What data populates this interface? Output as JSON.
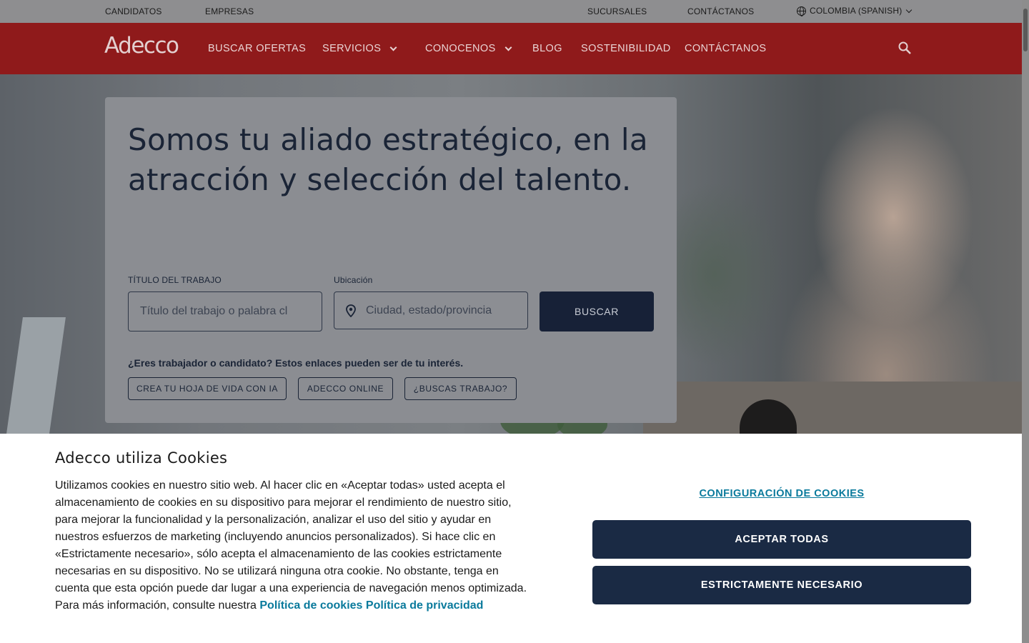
{
  "utility_bar": {
    "candidatos": "CANDIDATOS",
    "empresas": "EMPRESAS",
    "sucursales": "SUCURSALES",
    "contactanos": "CONTÁCTANOS",
    "language": "COLOMBIA (SPANISH)"
  },
  "nav": {
    "logo": "Adecco",
    "items": [
      {
        "label": "BUSCAR OFERTAS"
      },
      {
        "label": "SERVICIOS"
      },
      {
        "label": "CONOCENOS"
      },
      {
        "label": "BLOG"
      },
      {
        "label": "SOSTENIBILIDAD"
      },
      {
        "label": "CONTÁCTANOS"
      }
    ]
  },
  "hero": {
    "title": "Somos tu aliado estratégico, en la atracción y selección del talento.",
    "job_title_label": "TÍTULO DEL TRABAJO",
    "job_title_placeholder": "Título del trabajo o palabra cl",
    "location_label": "Ubicación",
    "location_placeholder": "Ciudad, estado/provincia",
    "search_button": "BUSCAR",
    "question": "¿Eres trabajador o candidato? Estos enlaces pueden ser de tu interés.",
    "chips": [
      {
        "label": "CREA TU HOJA DE VIDA CON IA"
      },
      {
        "label": "ADECCO ONLINE"
      },
      {
        "label": "¿BUSCAS TRABAJO?"
      }
    ]
  },
  "cookie_banner": {
    "title": "Adecco utiliza Cookies",
    "body": "Utilizamos cookies en nuestro sitio web. Al hacer clic en «Aceptar todas» usted acepta el almacenamiento de cookies en su dispositivo para mejorar el rendimiento de nuestro sitio, para mejorar la funcionalidad y la personalización, analizar el uso del sitio y ayudar en nuestros esfuerzos de marketing (incluyendo anuncios personalizados). Si hace clic en «Estrictamente necesario», sólo acepta el almacenamiento de las cookies estrictamente necesarias en su dispositivo. No se utilizará ninguna otra cookie. No obstante, tenga en cuenta que esta opción puede dar lugar a una experiencia de navegación menos optimizada. Para más información, consulte nuestra",
    "cookie_policy_link": "Política de cookies",
    "privacy_policy_link": "Política de privacidad",
    "settings_link": "CONFIGURACIÓN DE COOKIES",
    "accept_all": "ACEPTAR TODAS",
    "strictly_necessary": "ESTRICTAMENTE NECESARIO"
  },
  "colors": {
    "brand_red": "#8f1a1b",
    "navy": "#1a2a44",
    "link_teal": "#0a7a9c"
  }
}
